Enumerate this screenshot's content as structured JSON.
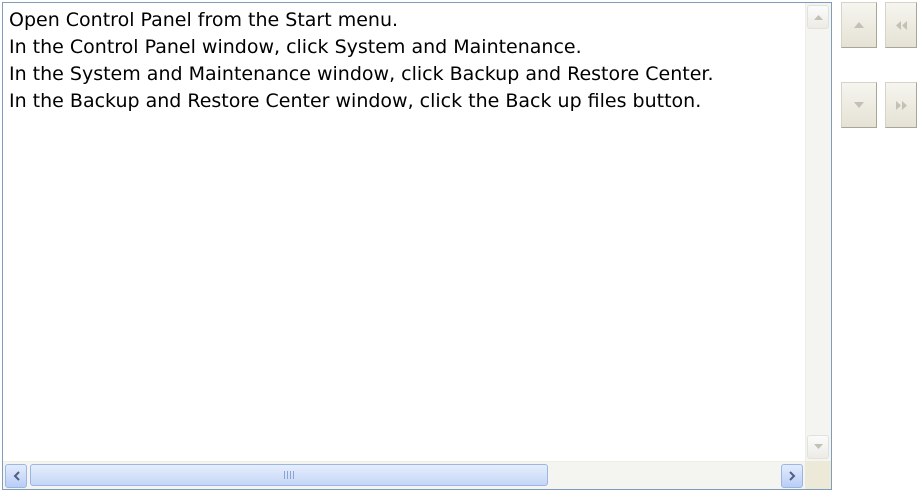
{
  "listbox": {
    "items": [
      "Open Control Panel from the Start menu.",
      "In the Control Panel window, click System and Maintenance.",
      "In the System and Maintenance window, click Backup and Restore Center.",
      "In the Backup and Restore Center window, click the Back up files button."
    ]
  },
  "horizontal_scrollbar": {
    "thumb_position_fraction": 0.0,
    "visible_fraction": 0.67
  },
  "icons": {
    "scroll_up": "triangle-up-icon",
    "scroll_down": "triangle-down-icon",
    "scroll_left": "triangle-left-icon",
    "scroll_right": "triangle-right-icon",
    "move_up": "triangle-up-icon",
    "move_down": "triangle-down-icon",
    "move_top": "double-chevron-left-icon",
    "move_bottom": "double-chevron-right-icon"
  },
  "colors": {
    "list_border": "#7f9db9",
    "scroll_arrow_active": "#4d6185",
    "disabled_glyph": "#c3c1b4"
  }
}
